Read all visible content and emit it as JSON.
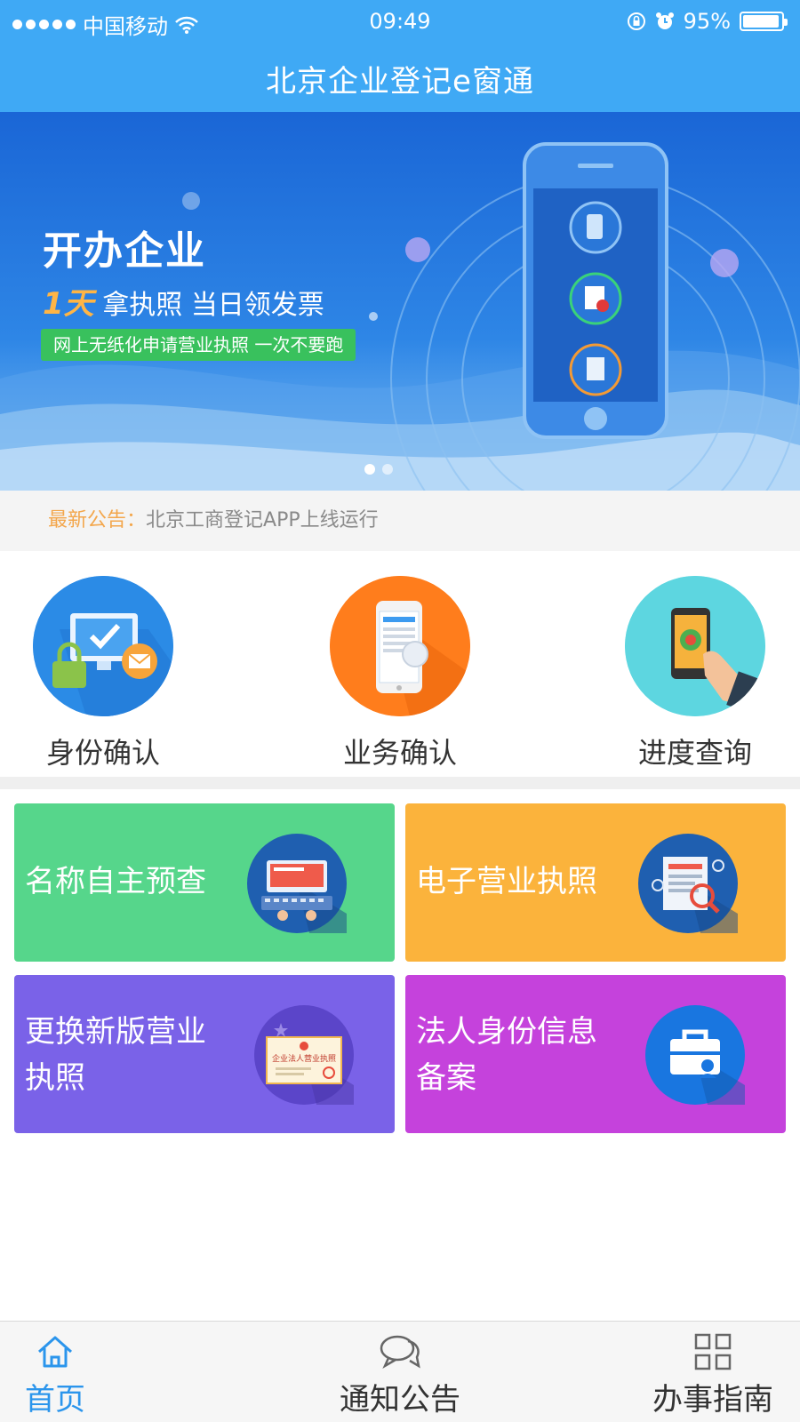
{
  "status_bar": {
    "carrier": "中国移动",
    "time": "09:49",
    "battery": "95%"
  },
  "app_title": "北京企业登记e窗通",
  "banner": {
    "title": "开办企业",
    "highlight": "1天",
    "subtitle": "拿执照 当日领发票",
    "tagline": "网上无纸化申请营业执照  一次不要跑",
    "page_count": 2,
    "active_page": 1
  },
  "notice": {
    "label": "最新公告：",
    "text": "北京工商登记APP上线运行"
  },
  "quick_actions": [
    {
      "label": "身份确认",
      "icon": "identity-lock-monitor-icon"
    },
    {
      "label": "业务确认",
      "icon": "phone-app-icon"
    },
    {
      "label": "进度查询",
      "icon": "hand-touch-phone-icon"
    }
  ],
  "cards": [
    {
      "label": "名称自主预查",
      "color": "#56d68b",
      "icon": "keyboard-monitor-icon"
    },
    {
      "label": "电子营业执照",
      "color": "#fbb33c",
      "icon": "document-magnifier-icon"
    },
    {
      "label_line1": "更换新版营业",
      "label_line2": "执照",
      "color": "#7a62e8",
      "icon": "business-license-icon",
      "icon_text": "企业法人营业执照"
    },
    {
      "label_line1": "法人身份信息",
      "label_line2": "备案",
      "color": "#c542dc",
      "icon": "briefcase-person-icon"
    }
  ],
  "tabs": [
    {
      "label": "首页",
      "icon": "home-icon",
      "active": true
    },
    {
      "label": "通知公告",
      "icon": "chat-bubbles-icon",
      "active": false
    },
    {
      "label": "办事指南",
      "icon": "grid-icon",
      "active": false
    }
  ],
  "colors": {
    "header": "#3fa9f5",
    "active_tab": "#2b95ec",
    "notice_label": "#f3a64b"
  }
}
